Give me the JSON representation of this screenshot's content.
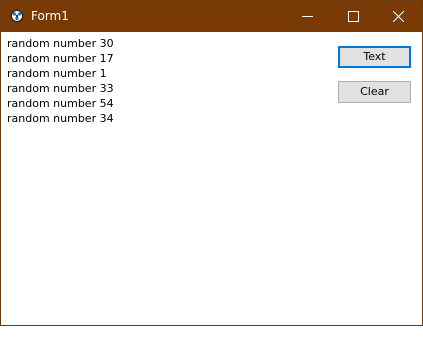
{
  "window": {
    "title": "Form1",
    "titlebar_color": "#7a3a06",
    "icons": {
      "app": "app-icon",
      "minimize": "minimize-icon",
      "maximize": "maximize-icon",
      "close": "close-icon"
    }
  },
  "list": {
    "items": [
      "random number 30",
      "random number 17",
      "random number 1",
      "random number 33",
      "random number 54",
      "random number 34"
    ]
  },
  "buttons": {
    "text_label": "Text",
    "clear_label": "Clear"
  },
  "colors": {
    "focus_border": "#0078d7",
    "button_face": "#e1e1e1"
  }
}
